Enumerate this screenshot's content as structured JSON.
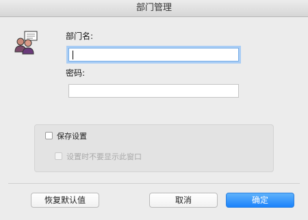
{
  "window": {
    "title": "部门管理"
  },
  "form": {
    "dept_name_label": "部门名:",
    "dept_name_value": "",
    "password_label": "密码:",
    "password_value": ""
  },
  "options": {
    "save_settings_label": "保存设置",
    "save_settings_checked": false,
    "dont_show_label": "设置时不要显示此窗口",
    "dont_show_checked": false,
    "dont_show_enabled": false
  },
  "buttons": {
    "restore_defaults": "恢复默认值",
    "cancel": "取消",
    "ok": "确定"
  },
  "icons": {
    "avatar": "user-group-message-icon"
  },
  "colors": {
    "accent": "#1a82fb",
    "focus_ring": "#a9cdf5"
  }
}
